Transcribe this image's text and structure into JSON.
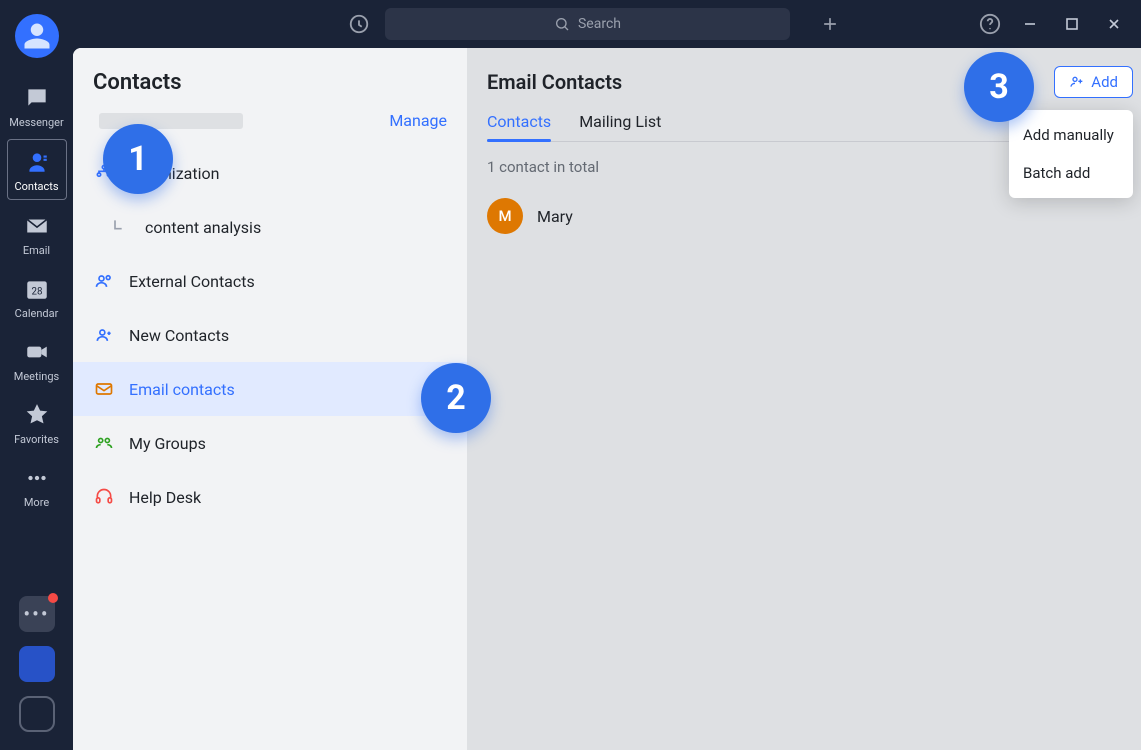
{
  "search": {
    "placeholder": "Search"
  },
  "rail": {
    "items": [
      {
        "label": "Messenger"
      },
      {
        "label": "Contacts"
      },
      {
        "label": "Email"
      },
      {
        "label": "Calendar",
        "day": "28"
      },
      {
        "label": "Meetings"
      },
      {
        "label": "Favorites"
      },
      {
        "label": "More"
      }
    ]
  },
  "sidebar": {
    "title": "Contacts",
    "manage_label": "Manage",
    "items": [
      {
        "label": "Organization"
      },
      {
        "label": "content analysis"
      },
      {
        "label": "External Contacts"
      },
      {
        "label": "New Contacts"
      },
      {
        "label": "Email contacts"
      },
      {
        "label": "My Groups"
      },
      {
        "label": "Help Desk"
      }
    ]
  },
  "detail": {
    "title": "Email Contacts",
    "tabs": [
      {
        "label": "Contacts"
      },
      {
        "label": "Mailing List"
      }
    ],
    "count_text": "1 contact in total",
    "contacts": [
      {
        "initial": "M",
        "name": "Mary"
      }
    ],
    "add_button": "Add",
    "dropdown": [
      "Add manually",
      "Batch add"
    ]
  },
  "annotations": {
    "c1": "1",
    "c2": "2",
    "c3": "3"
  }
}
